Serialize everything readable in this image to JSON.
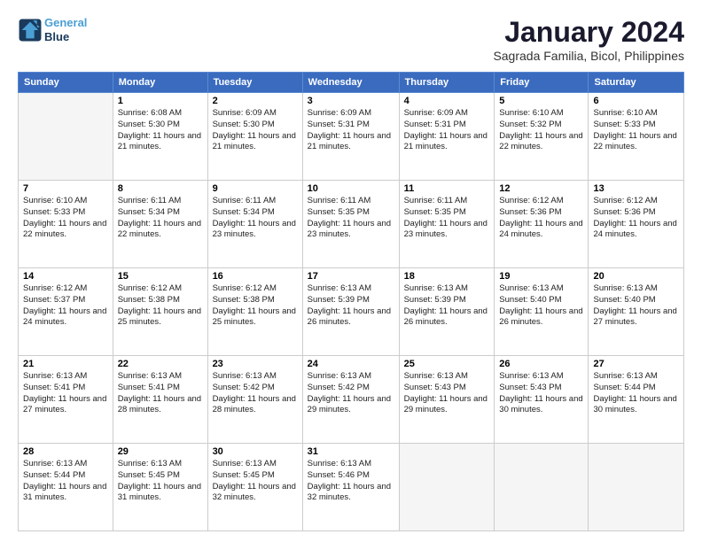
{
  "logo": {
    "line1": "General",
    "line2": "Blue"
  },
  "title": "January 2024",
  "subtitle": "Sagrada Familia, Bicol, Philippines",
  "days_header": [
    "Sunday",
    "Monday",
    "Tuesday",
    "Wednesday",
    "Thursday",
    "Friday",
    "Saturday"
  ],
  "weeks": [
    [
      {
        "day": "",
        "empty": true
      },
      {
        "day": "1",
        "sunrise": "6:08 AM",
        "sunset": "5:30 PM",
        "daylight": "11 hours and 21 minutes."
      },
      {
        "day": "2",
        "sunrise": "6:09 AM",
        "sunset": "5:30 PM",
        "daylight": "11 hours and 21 minutes."
      },
      {
        "day": "3",
        "sunrise": "6:09 AM",
        "sunset": "5:31 PM",
        "daylight": "11 hours and 21 minutes."
      },
      {
        "day": "4",
        "sunrise": "6:09 AM",
        "sunset": "5:31 PM",
        "daylight": "11 hours and 21 minutes."
      },
      {
        "day": "5",
        "sunrise": "6:10 AM",
        "sunset": "5:32 PM",
        "daylight": "11 hours and 22 minutes."
      },
      {
        "day": "6",
        "sunrise": "6:10 AM",
        "sunset": "5:33 PM",
        "daylight": "11 hours and 22 minutes."
      }
    ],
    [
      {
        "day": "7",
        "sunrise": "6:10 AM",
        "sunset": "5:33 PM",
        "daylight": "11 hours and 22 minutes."
      },
      {
        "day": "8",
        "sunrise": "6:11 AM",
        "sunset": "5:34 PM",
        "daylight": "11 hours and 22 minutes."
      },
      {
        "day": "9",
        "sunrise": "6:11 AM",
        "sunset": "5:34 PM",
        "daylight": "11 hours and 23 minutes."
      },
      {
        "day": "10",
        "sunrise": "6:11 AM",
        "sunset": "5:35 PM",
        "daylight": "11 hours and 23 minutes."
      },
      {
        "day": "11",
        "sunrise": "6:11 AM",
        "sunset": "5:35 PM",
        "daylight": "11 hours and 23 minutes."
      },
      {
        "day": "12",
        "sunrise": "6:12 AM",
        "sunset": "5:36 PM",
        "daylight": "11 hours and 24 minutes."
      },
      {
        "day": "13",
        "sunrise": "6:12 AM",
        "sunset": "5:36 PM",
        "daylight": "11 hours and 24 minutes."
      }
    ],
    [
      {
        "day": "14",
        "sunrise": "6:12 AM",
        "sunset": "5:37 PM",
        "daylight": "11 hours and 24 minutes."
      },
      {
        "day": "15",
        "sunrise": "6:12 AM",
        "sunset": "5:38 PM",
        "daylight": "11 hours and 25 minutes."
      },
      {
        "day": "16",
        "sunrise": "6:12 AM",
        "sunset": "5:38 PM",
        "daylight": "11 hours and 25 minutes."
      },
      {
        "day": "17",
        "sunrise": "6:13 AM",
        "sunset": "5:39 PM",
        "daylight": "11 hours and 26 minutes."
      },
      {
        "day": "18",
        "sunrise": "6:13 AM",
        "sunset": "5:39 PM",
        "daylight": "11 hours and 26 minutes."
      },
      {
        "day": "19",
        "sunrise": "6:13 AM",
        "sunset": "5:40 PM",
        "daylight": "11 hours and 26 minutes."
      },
      {
        "day": "20",
        "sunrise": "6:13 AM",
        "sunset": "5:40 PM",
        "daylight": "11 hours and 27 minutes."
      }
    ],
    [
      {
        "day": "21",
        "sunrise": "6:13 AM",
        "sunset": "5:41 PM",
        "daylight": "11 hours and 27 minutes."
      },
      {
        "day": "22",
        "sunrise": "6:13 AM",
        "sunset": "5:41 PM",
        "daylight": "11 hours and 28 minutes."
      },
      {
        "day": "23",
        "sunrise": "6:13 AM",
        "sunset": "5:42 PM",
        "daylight": "11 hours and 28 minutes."
      },
      {
        "day": "24",
        "sunrise": "6:13 AM",
        "sunset": "5:42 PM",
        "daylight": "11 hours and 29 minutes."
      },
      {
        "day": "25",
        "sunrise": "6:13 AM",
        "sunset": "5:43 PM",
        "daylight": "11 hours and 29 minutes."
      },
      {
        "day": "26",
        "sunrise": "6:13 AM",
        "sunset": "5:43 PM",
        "daylight": "11 hours and 30 minutes."
      },
      {
        "day": "27",
        "sunrise": "6:13 AM",
        "sunset": "5:44 PM",
        "daylight": "11 hours and 30 minutes."
      }
    ],
    [
      {
        "day": "28",
        "sunrise": "6:13 AM",
        "sunset": "5:44 PM",
        "daylight": "11 hours and 31 minutes."
      },
      {
        "day": "29",
        "sunrise": "6:13 AM",
        "sunset": "5:45 PM",
        "daylight": "11 hours and 31 minutes."
      },
      {
        "day": "30",
        "sunrise": "6:13 AM",
        "sunset": "5:45 PM",
        "daylight": "11 hours and 32 minutes."
      },
      {
        "day": "31",
        "sunrise": "6:13 AM",
        "sunset": "5:46 PM",
        "daylight": "11 hours and 32 minutes."
      },
      {
        "day": "",
        "empty": true
      },
      {
        "day": "",
        "empty": true
      },
      {
        "day": "",
        "empty": true
      }
    ]
  ],
  "labels": {
    "sunrise_prefix": "Sunrise: ",
    "sunset_prefix": "Sunset: ",
    "daylight_prefix": "Daylight: "
  }
}
